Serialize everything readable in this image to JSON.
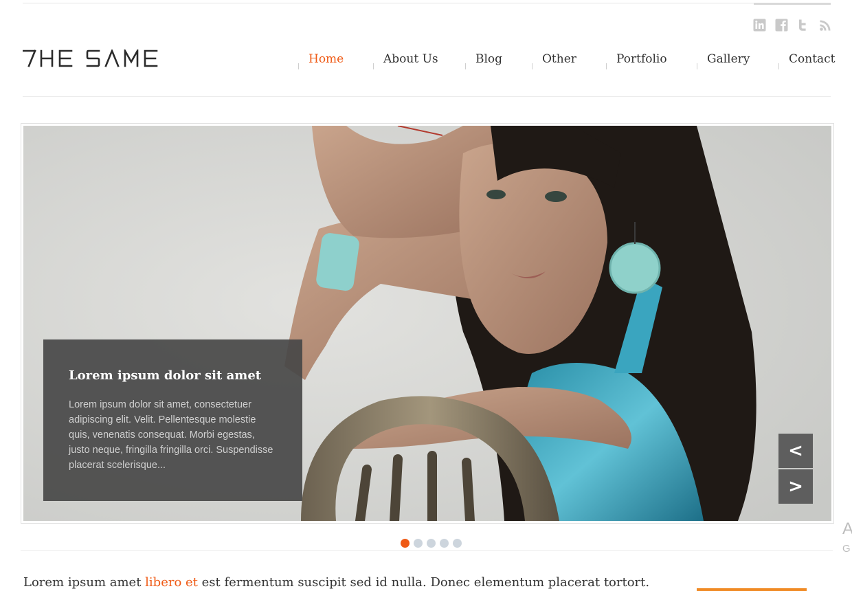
{
  "brand": {
    "logo_text": "THE SAME"
  },
  "social": [
    {
      "name": "linkedin-icon"
    },
    {
      "name": "facebook-icon"
    },
    {
      "name": "twitter-icon"
    },
    {
      "name": "rss-icon"
    }
  ],
  "nav": {
    "items": [
      {
        "label": "Home",
        "active": true
      },
      {
        "label": "About Us",
        "active": false
      },
      {
        "label": "Blog",
        "active": false
      },
      {
        "label": "Other",
        "active": false
      },
      {
        "label": "Portfolio",
        "active": false
      },
      {
        "label": "Gallery",
        "active": false
      },
      {
        "label": "Contact",
        "active": false
      }
    ]
  },
  "slider": {
    "caption_title": "Lorem ipsum dolor sit amet",
    "caption_text": "Lorem ipsum dolor sit amet, consectetuer adipiscing elit. Velit. Pellentesque molestie quis, venenatis consequat. Morbi egestas, justo neque, fringilla fringilla orci. Suspendisse placerat scelerisque...",
    "prev_label": "<",
    "next_label": ">",
    "slide_count": 5,
    "active_slide": 1
  },
  "side": {
    "letter": "A",
    "letter2": "G"
  },
  "tagline": {
    "before": "Lorem ipsum amet ",
    "highlight": "libero et",
    "after": " est fermentum suscipit sed id nulla. Donec elementum placerat tortort."
  },
  "colors": {
    "accent": "#ef5a15",
    "caption_bg": "#484848",
    "dot_inactive": "#cdd5dd"
  }
}
